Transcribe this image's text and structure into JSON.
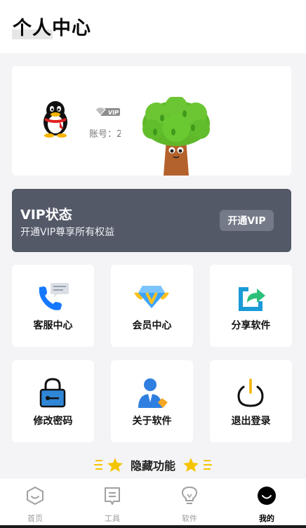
{
  "header": {
    "title": "个人中心"
  },
  "profile": {
    "account_text": "账号：2",
    "vip_badge_text": "VIP",
    "avatar_icon": "qq-penguin-icon",
    "mascot_icon": "tree-mascot-icon"
  },
  "vip": {
    "title": "VIP状态",
    "subtitle": "开通VIP尊享所有权益",
    "button_label": "开通VIP"
  },
  "tiles": [
    {
      "label": "客服中心",
      "icon": "customer-service-icon"
    },
    {
      "label": "会员中心",
      "icon": "member-diamond-icon"
    },
    {
      "label": "分享软件",
      "icon": "share-icon"
    },
    {
      "label": "修改密码",
      "icon": "lock-icon"
    },
    {
      "label": "关于软件",
      "icon": "about-person-icon"
    },
    {
      "label": "退出登录",
      "icon": "power-icon"
    }
  ],
  "hidden_feature": {
    "label": "隐藏功能"
  },
  "tabbar": {
    "items": [
      {
        "label": "首页",
        "icon": "home-hexagon-icon",
        "active": false
      },
      {
        "label": "工具",
        "icon": "tools-doc-icon",
        "active": false
      },
      {
        "label": "软件",
        "icon": "bulb-icon",
        "active": false
      },
      {
        "label": "我的",
        "icon": "profile-smile-icon",
        "active": true
      }
    ]
  },
  "colors": {
    "vip_card_bg": "#545968",
    "vip_button_bg": "#747a88",
    "accent_blue": "#1677ff",
    "page_bg": "#f4f4f6"
  }
}
